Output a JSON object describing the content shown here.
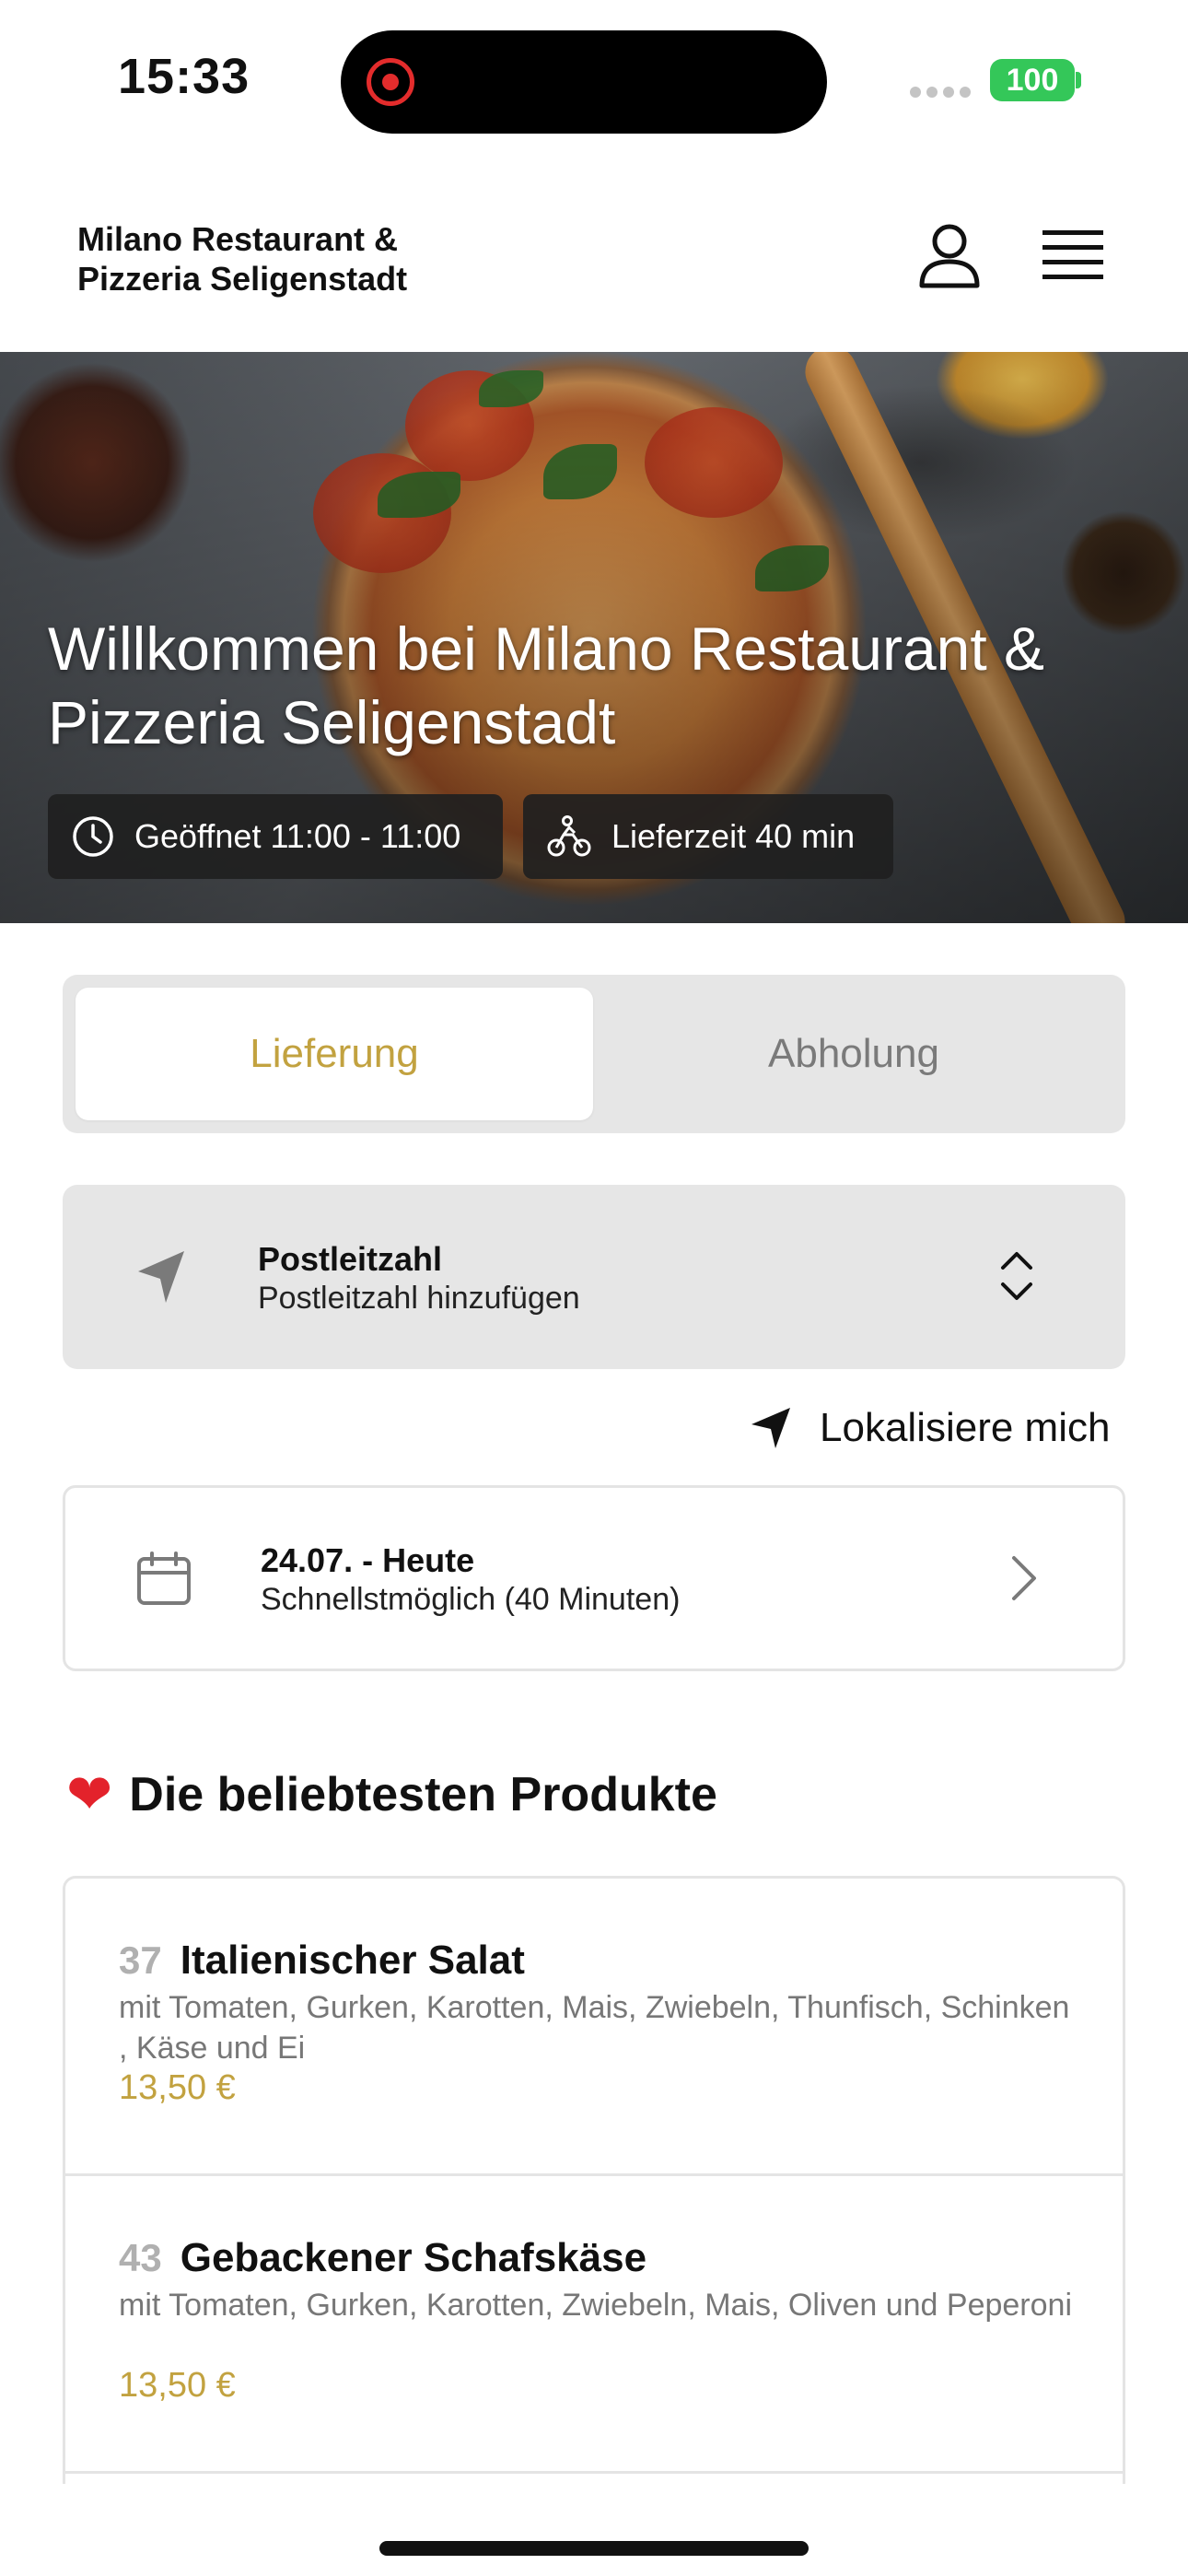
{
  "status_bar": {
    "time": "15:33",
    "battery": "100"
  },
  "header": {
    "brand": "Milano Restaurant & Pizzeria Seligenstadt"
  },
  "hero": {
    "title": "Willkommen bei Milano Restaurant & Pizzeria Seligenstadt",
    "open_hours": "Geöffnet 11:00 - 11:00",
    "delivery_time": "Lieferzeit 40 min"
  },
  "order_mode": {
    "options": [
      "Lieferung",
      "Abholung"
    ],
    "selected": "Lieferung"
  },
  "postcode": {
    "label": "Postleitzahl",
    "placeholder": "Postleitzahl hinzufügen"
  },
  "locate": {
    "label": "Lokalisiere mich"
  },
  "schedule": {
    "date": "24.07. - Heute",
    "time": "Schnellstmöglich (40 Minuten)"
  },
  "popular": {
    "title": "Die beliebtesten Produkte",
    "items": [
      {
        "number": "37",
        "name": "Italienischer Salat",
        "description": "mit Tomaten, Gurken, Karotten, Mais, Zwiebeln, Thunfisch, Schinken , Käse und Ei",
        "price": "13,50 €"
      },
      {
        "number": "43",
        "name": "Gebackener Schafskäse",
        "description": "mit Tomaten, Gurken, Karotten, Zwiebeln, Mais, Oliven und Peperoni",
        "price": "13,50 €"
      }
    ]
  },
  "colors": {
    "accent": "#c2a240",
    "panel": "#e6e6e6",
    "battery": "#34c759",
    "record": "#e32c2c",
    "heart": "#e3222b"
  },
  "icons": {
    "user": "user-icon",
    "menu": "hamburger-menu-icon",
    "clock": "clock-icon",
    "bike": "bike-courier-icon",
    "navigation": "navigation-arrow-icon",
    "stepper": "chevron-up-down-icon",
    "calendar": "calendar-icon",
    "chevron": "chevron-right-icon",
    "heart": "heart-icon"
  }
}
